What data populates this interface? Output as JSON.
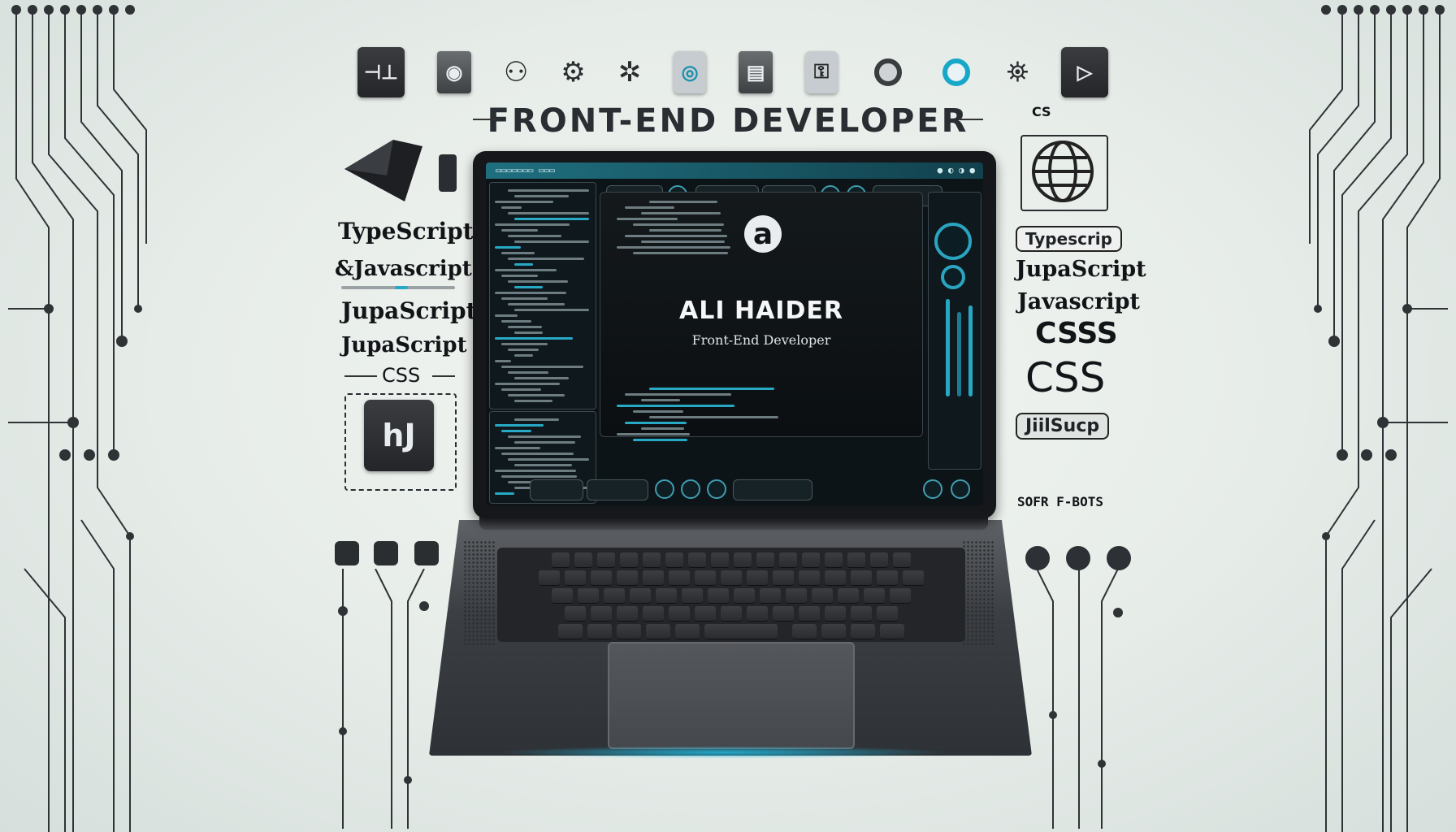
{
  "header": {
    "title": "FRONT-END DEVELOPER"
  },
  "top_icons": [
    "code-icon",
    "eye-icon",
    "user-group-icon",
    "gear-users-icon",
    "settings-icon",
    "screen-icon",
    "window-icon",
    "key-icon",
    "record-icon",
    "target-icon",
    "camera-icon",
    "play-icon"
  ],
  "top_tile_texts": {
    "code": "⊣⊥",
    "play": "▷"
  },
  "left_labels": {
    "typescript": "TypeScript",
    "javascript": "&Javascript",
    "jupascript1": "JupaScript",
    "jupascript2": "JupaScript",
    "css": "CSS",
    "hj_tile": "hJ"
  },
  "right_labels": {
    "top_small": "CS",
    "typescrip": "Typescrip",
    "jupascript": "JupaScript",
    "javascript": "Javascript",
    "csss": "CSSS",
    "css": "CSS",
    "jiilsucp": "JiilSucp",
    "code_text": "SOFR F-BOTS"
  },
  "screen": {
    "name": "ALI HAIDER",
    "role": "Front-End Developer",
    "logo_letter": "a"
  },
  "colors": {
    "accent": "#27a9c6",
    "dark": "#15171a"
  }
}
